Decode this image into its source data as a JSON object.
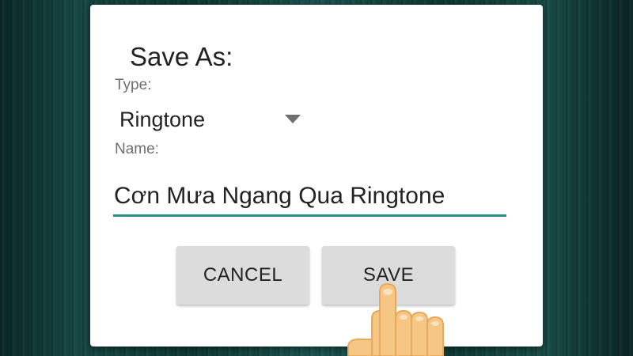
{
  "dialog": {
    "title": "Save As:",
    "type_label": "Type:",
    "type_value": "Ringtone",
    "name_label": "Name:",
    "name_value": "Cơn Mưa Ngang Qua Ringtone",
    "cancel_label": "CANCEL",
    "save_label": "SAVE"
  },
  "colors": {
    "accent_underline": "#2e8c82",
    "button_bg": "#dcdcdc",
    "background": "#0f3a37"
  },
  "icons": {
    "dropdown": "triangle-down-icon",
    "pointer": "pointing-hand-icon"
  }
}
